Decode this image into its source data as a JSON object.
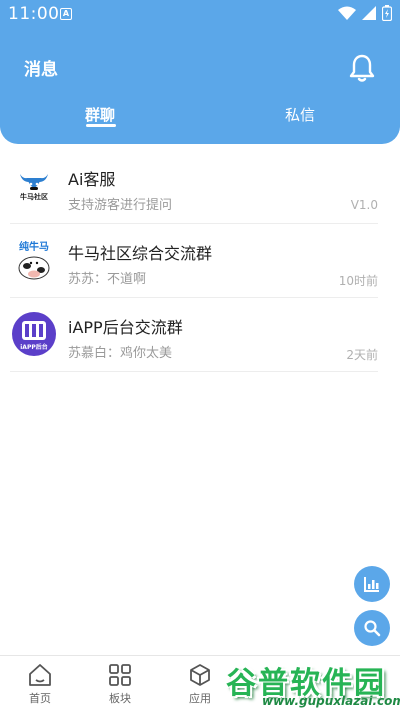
{
  "status_bar": {
    "time": "11:00",
    "notification_icon": "A"
  },
  "header": {
    "title": "消息",
    "bell_icon": "bell-icon",
    "tabs": [
      {
        "label": "群聊",
        "active": true
      },
      {
        "label": "私信",
        "active": false
      }
    ],
    "accent_color": "#5ba7e9"
  },
  "conversations": [
    {
      "name": "Ai客服",
      "subtitle": "支持游客进行提问",
      "meta": "V1.0",
      "avatar_text": "牛马社区"
    },
    {
      "name": "牛马社区综合交流群",
      "subtitle": "苏苏：不道啊",
      "meta": "10时前",
      "avatar_text": "纯牛马"
    },
    {
      "name": "iAPP后台交流群",
      "subtitle": "苏慕白：鸡你太美",
      "meta": "2天前",
      "avatar_text": "iAPP后台"
    }
  ],
  "floating_buttons": [
    "chart-icon",
    "search-icon"
  ],
  "bottom_nav": [
    {
      "label": "首页",
      "icon": "home-icon"
    },
    {
      "label": "板块",
      "icon": "grid-icon"
    },
    {
      "label": "应用",
      "icon": "box-icon"
    }
  ],
  "watermark": {
    "title": "谷普软件园",
    "url": "www.gupuxlazai.com"
  }
}
